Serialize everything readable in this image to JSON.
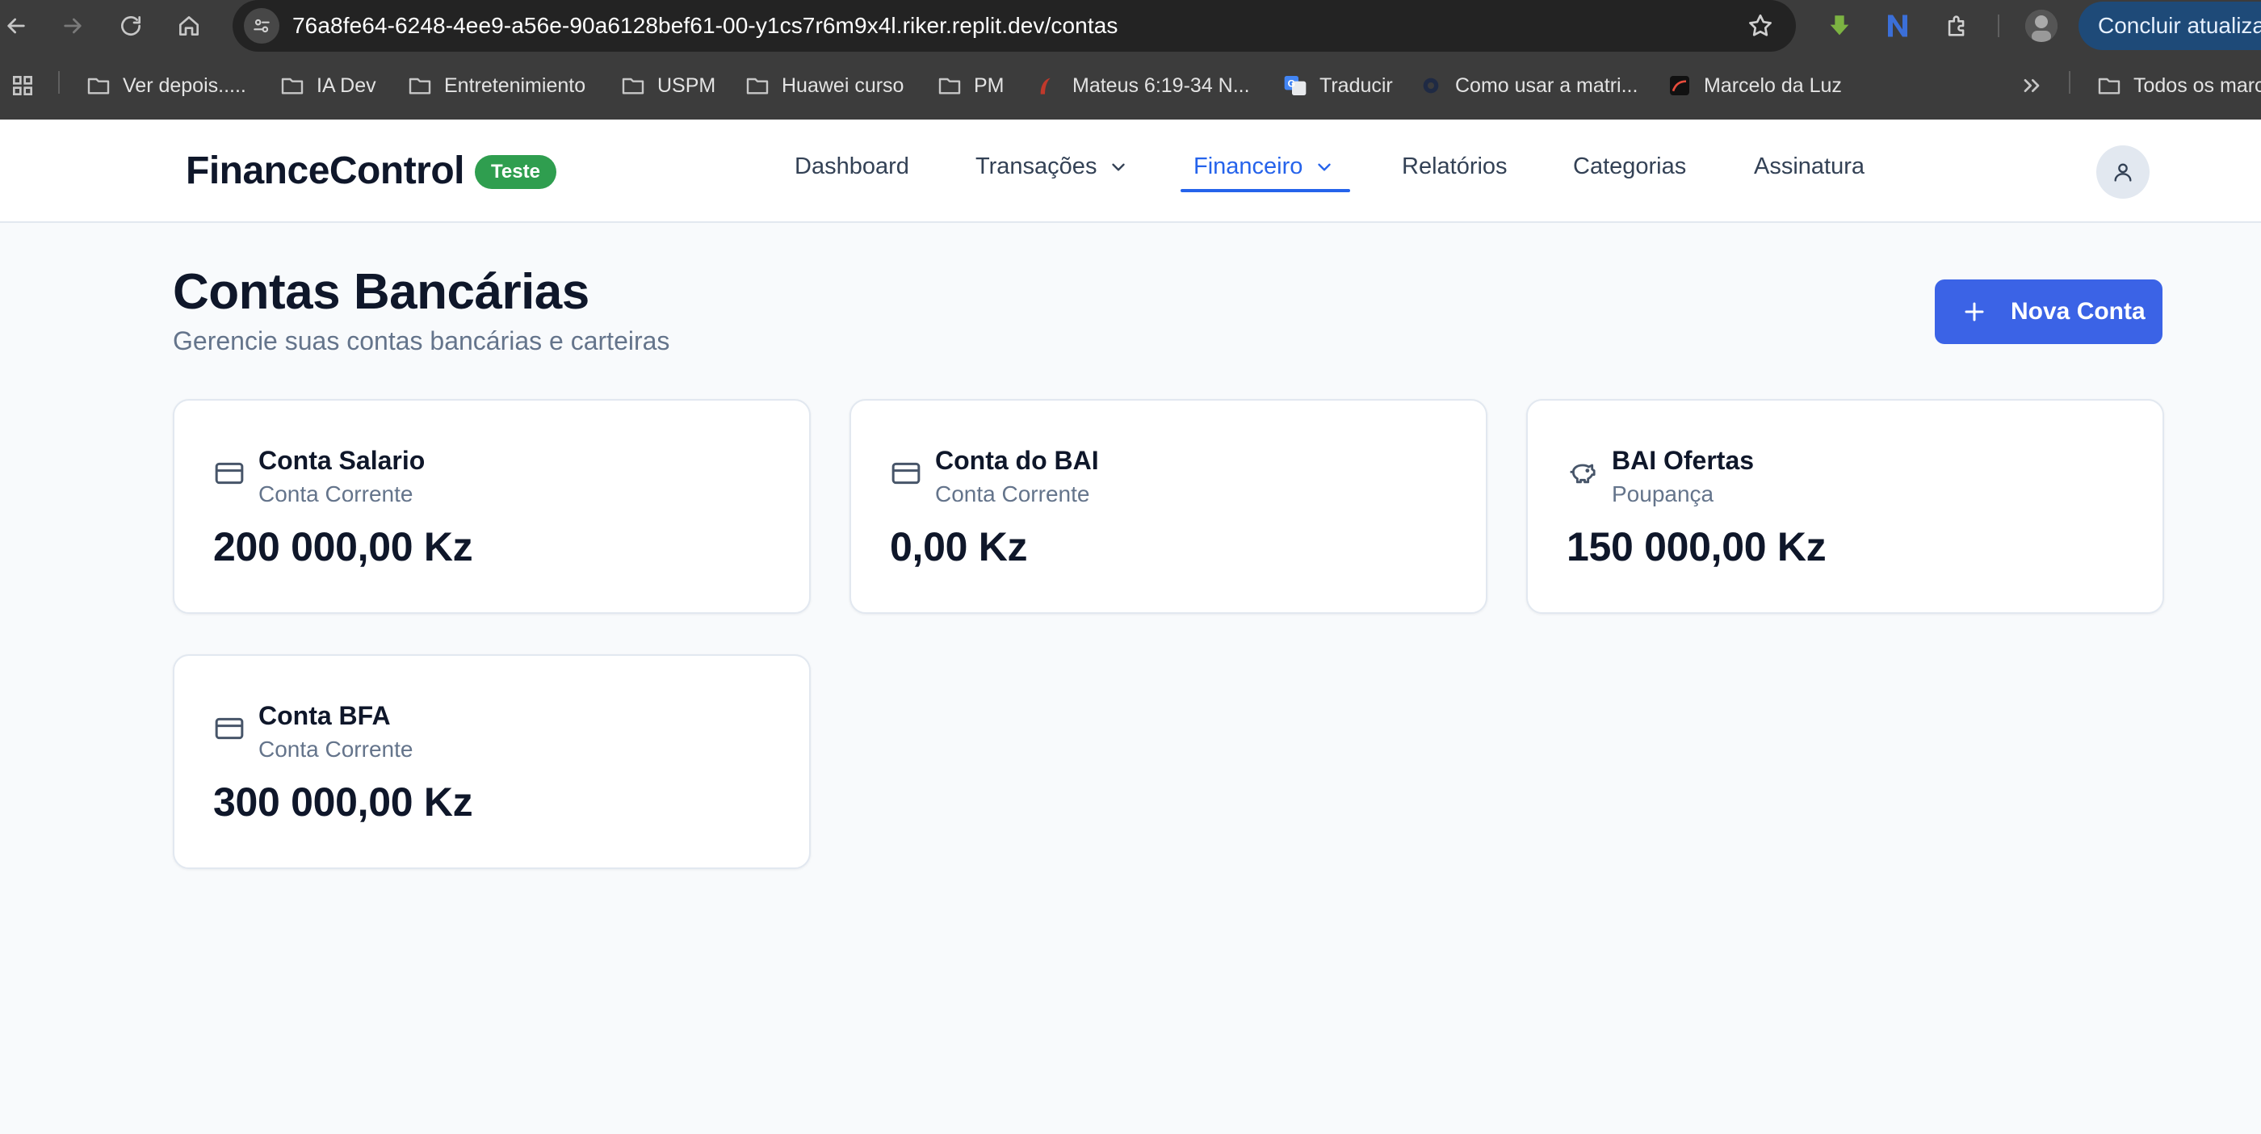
{
  "browser": {
    "url": "76a8fe64-6248-4ee9-a56e-90a6128bef61-00-y1cs7r6m9x4l.riker.replit.dev/contas",
    "update_button": "Concluir atualiza",
    "bookmarks": [
      {
        "label": "Ver depois.....",
        "icon": "folder-icon"
      },
      {
        "label": "IA Dev",
        "icon": "folder-icon"
      },
      {
        "label": "Entretenimiento",
        "icon": "folder-icon"
      },
      {
        "label": "USPM",
        "icon": "folder-icon"
      },
      {
        "label": "Huawei curso",
        "icon": "folder-icon"
      },
      {
        "label": "PM",
        "icon": "folder-icon"
      },
      {
        "label": "Mateus 6:19-34 N...",
        "icon": "bible-icon"
      },
      {
        "label": "Traducir",
        "icon": "translate-icon"
      },
      {
        "label": "Como usar a matri...",
        "icon": "generic-site-icon"
      },
      {
        "label": "Marcelo da Luz",
        "icon": "site-logo-icon"
      }
    ],
    "all_bookmarks": "Todos os marc"
  },
  "app": {
    "brand": "FinanceControl",
    "badge": "Teste",
    "nav": {
      "dashboard": "Dashboard",
      "transacoes": "Transações",
      "financeiro": "Financeiro",
      "relatorios": "Relatórios",
      "categorias": "Categorias",
      "assinatura": "Assinatura"
    },
    "active_nav": "Financeiro",
    "accent_color": "#2563eb"
  },
  "page": {
    "title": "Contas Bancárias",
    "subtitle": "Gerencie suas contas bancárias e carteiras",
    "new_button": "Nova Conta"
  },
  "accounts": [
    {
      "name": "Conta Salario",
      "type": "Conta Corrente",
      "balance": "200 000,00 Kz",
      "icon": "credit-card-icon"
    },
    {
      "name": "Conta do BAI",
      "type": "Conta Corrente",
      "balance": "0,00 Kz",
      "icon": "credit-card-icon"
    },
    {
      "name": "BAI Ofertas",
      "type": "Poupança",
      "balance": "150 000,00 Kz",
      "icon": "piggy-bank-icon"
    },
    {
      "name": "Conta BFA",
      "type": "Conta Corrente",
      "balance": "300 000,00 Kz",
      "icon": "credit-card-icon"
    }
  ]
}
